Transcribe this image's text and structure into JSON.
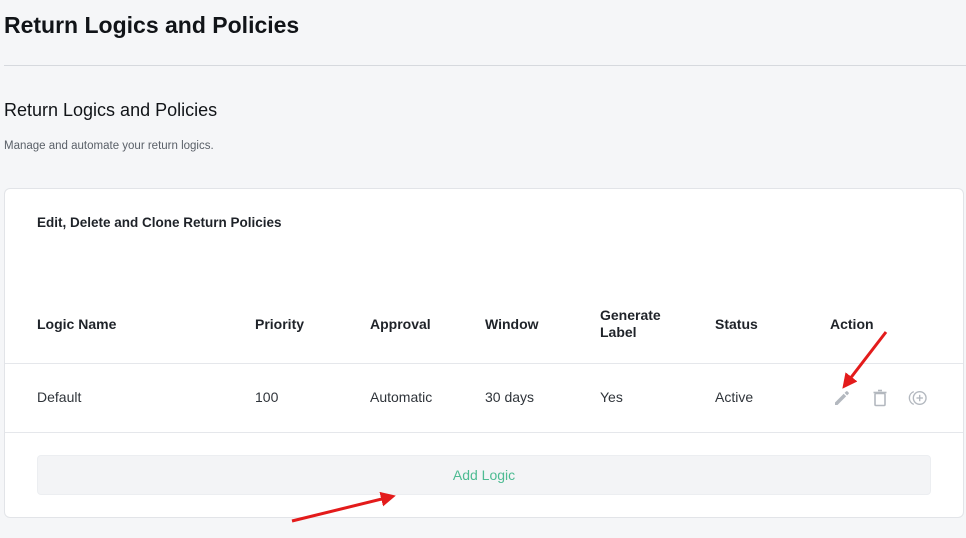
{
  "page": {
    "title": "Return Logics and Policies"
  },
  "section": {
    "title": "Return Logics and Policies",
    "subtitle": "Manage and automate your return logics."
  },
  "card": {
    "title": "Edit, Delete and Clone Return Policies"
  },
  "table": {
    "headers": {
      "logic_name": "Logic Name",
      "priority": "Priority",
      "approval": "Approval",
      "window": "Window",
      "generate_label": "Generate\nLabel",
      "status": "Status",
      "action": "Action"
    },
    "rows": [
      {
        "logic_name": "Default",
        "priority": "100",
        "approval": "Automatic",
        "window": "30 days",
        "generate_label": "Yes",
        "status": "Active"
      }
    ],
    "action_icons": [
      "pencil-icon",
      "trash-icon",
      "clone-icon"
    ]
  },
  "add_button": {
    "label": "Add Logic"
  },
  "colors": {
    "accent": "#4dbb92",
    "annotation_arrow": "#e31b1b",
    "icon_gray": "#b3b8bf"
  }
}
